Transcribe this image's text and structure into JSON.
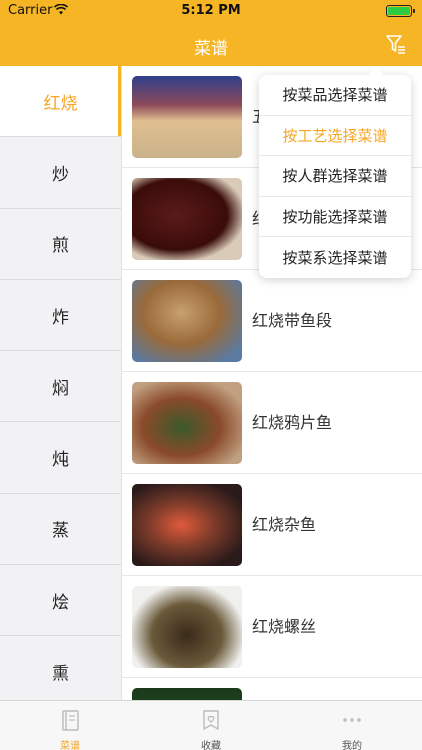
{
  "status_bar": {
    "carrier": "Carrier",
    "time": "5:12 PM",
    "wifi_icon": "wifi-icon",
    "battery_icon": "battery-icon"
  },
  "nav": {
    "title": "菜谱",
    "filter_icon": "filter-icon"
  },
  "sidebar": {
    "items": [
      {
        "label": "红烧",
        "active": true
      },
      {
        "label": "炒"
      },
      {
        "label": "煎"
      },
      {
        "label": "炸"
      },
      {
        "label": "焖"
      },
      {
        "label": "炖"
      },
      {
        "label": "蒸"
      },
      {
        "label": "烩"
      },
      {
        "label": "熏"
      }
    ]
  },
  "dishes": [
    {
      "name": "五"
    },
    {
      "name": "红"
    },
    {
      "name": "红烧带鱼段"
    },
    {
      "name": "红烧鸦片鱼"
    },
    {
      "name": "红烧杂鱼"
    },
    {
      "name": "红烧螺丝"
    },
    {
      "name": ""
    }
  ],
  "filter_menu": {
    "items": [
      {
        "label": "按菜品选择菜谱"
      },
      {
        "label": "按工艺选择菜谱",
        "active": true
      },
      {
        "label": "按人群选择菜谱"
      },
      {
        "label": "按功能选择菜谱"
      },
      {
        "label": "按菜系选择菜谱"
      }
    ]
  },
  "tabbar": {
    "tabs": [
      {
        "label": "菜谱",
        "icon": "book-icon",
        "active": true
      },
      {
        "label": "收藏",
        "icon": "favorite-icon"
      },
      {
        "label": "我的",
        "icon": "more-icon"
      }
    ]
  },
  "colors": {
    "accent": "#f5b524",
    "active_text": "#f5a623"
  }
}
